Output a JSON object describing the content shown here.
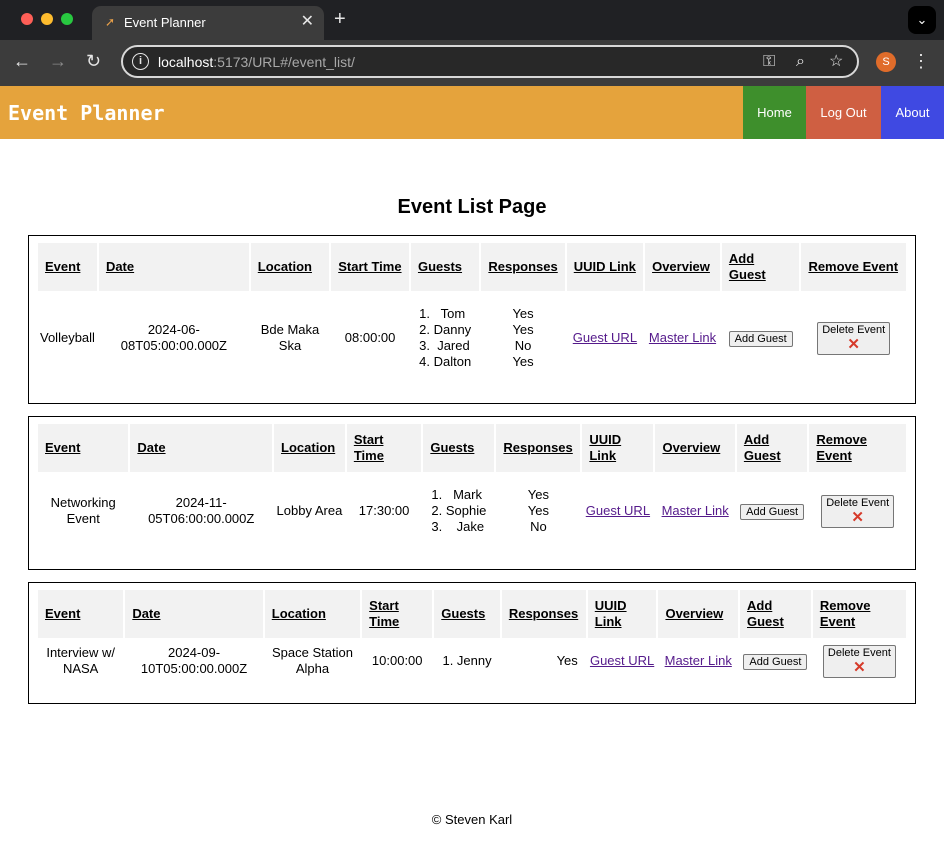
{
  "browser": {
    "tab_title": "Event Planner",
    "tab_favicon": "rocket-icon",
    "url_host": "localhost",
    "url_rest": ":5173/URL#/event_list/",
    "profile_initial": "S"
  },
  "header": {
    "title": "Event Planner",
    "nav": {
      "home": "Home",
      "logout": "Log Out",
      "about": "About"
    },
    "colors": {
      "bar": "#e5a33c",
      "home": "#3e8f2c",
      "logout": "#cf5f42",
      "about": "#3f49e2"
    }
  },
  "page": {
    "title": "Event List Page"
  },
  "columns": {
    "event": "Event",
    "date": "Date",
    "location": "Location",
    "start_time": "Start Time",
    "guests": "Guests",
    "responses": "Responses",
    "uuid_link": "UUID Link",
    "overview": "Overview",
    "add_guest": "Add Guest",
    "remove_event": "Remove Event"
  },
  "buttons": {
    "guest_url": "Guest URL",
    "master_link": "Master Link",
    "add_guest": "Add Guest",
    "delete_event": "Delete Event",
    "delete_icon": "✕"
  },
  "events": [
    {
      "name": "Volleyball",
      "date": "2024-06-08T05:00:00.000Z",
      "location": "Bde Maka Ska",
      "start_time": "08:00:00",
      "guests": [
        "1.   Tom",
        "2. Danny",
        "3.  Jared",
        "4. Dalton"
      ],
      "responses": [
        "Yes",
        "Yes",
        "No",
        "Yes"
      ]
    },
    {
      "name": "Networking Event",
      "date": "2024-11-05T06:00:00.000Z",
      "location": "Lobby Area",
      "start_time": "17:30:00",
      "guests": [
        "1.   Mark",
        "2. Sophie",
        "3.    Jake"
      ],
      "responses": [
        "Yes",
        "Yes",
        "No"
      ]
    },
    {
      "name": "Interview w/ NASA",
      "date": "2024-09-10T05:00:00.000Z",
      "location": "Space Station Alpha",
      "start_time": "10:00:00",
      "guests": [
        "1. Jenny"
      ],
      "responses": [
        "Yes"
      ]
    }
  ],
  "footer": {
    "text": "© Steven Karl"
  }
}
